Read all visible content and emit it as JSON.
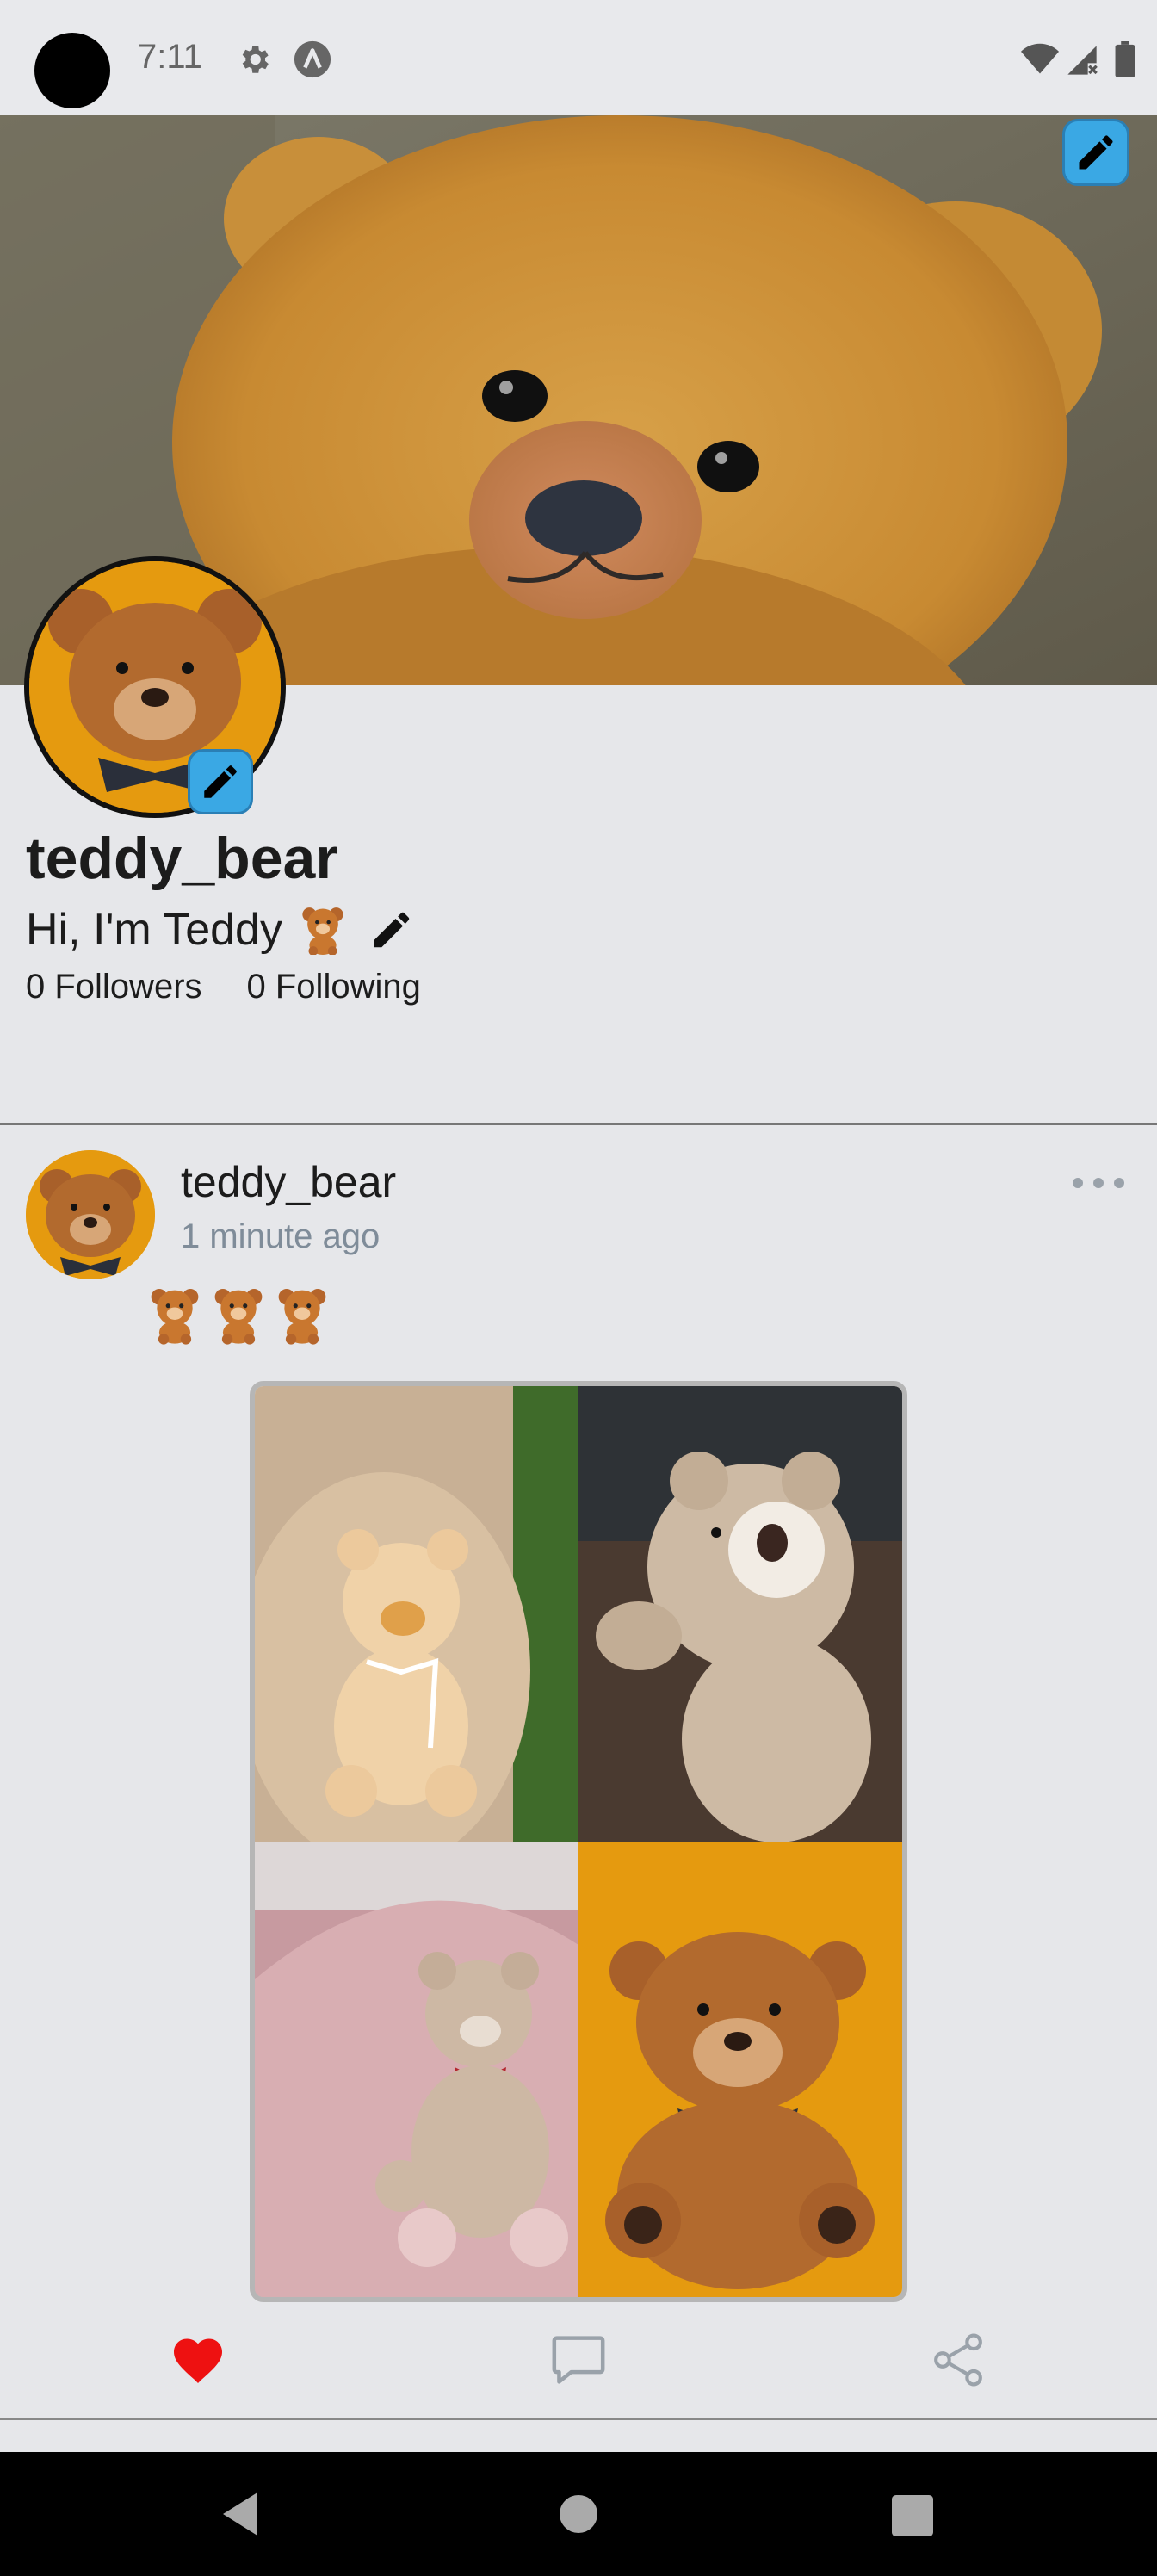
{
  "status_bar": {
    "time": "7:11",
    "icons": [
      "camera-dot",
      "gear-icon",
      "a-circle-icon",
      "wifi-icon",
      "signal-icon",
      "battery-icon"
    ]
  },
  "profile": {
    "username": "teddy_bear",
    "bio": "Hi, I'm Teddy",
    "followers": "0 Followers",
    "following": "0 Following"
  },
  "post": {
    "author": "teddy_bear",
    "time": "1 minute ago",
    "content_emoji_count": 3,
    "liked": true,
    "images": [
      "teddy-on-grass",
      "teddy-on-floor",
      "teddy-on-pink-chair",
      "teddy-on-orange"
    ]
  },
  "colors": {
    "background": "#e6e7ea",
    "edit_button": "#3aa8e4",
    "like_red": "#ee1111",
    "muted_text": "#7f8c99",
    "teddy_orange": "#e59a0f"
  },
  "navigation": {
    "icons": [
      "back-icon",
      "home-icon",
      "recent-apps-icon"
    ]
  }
}
